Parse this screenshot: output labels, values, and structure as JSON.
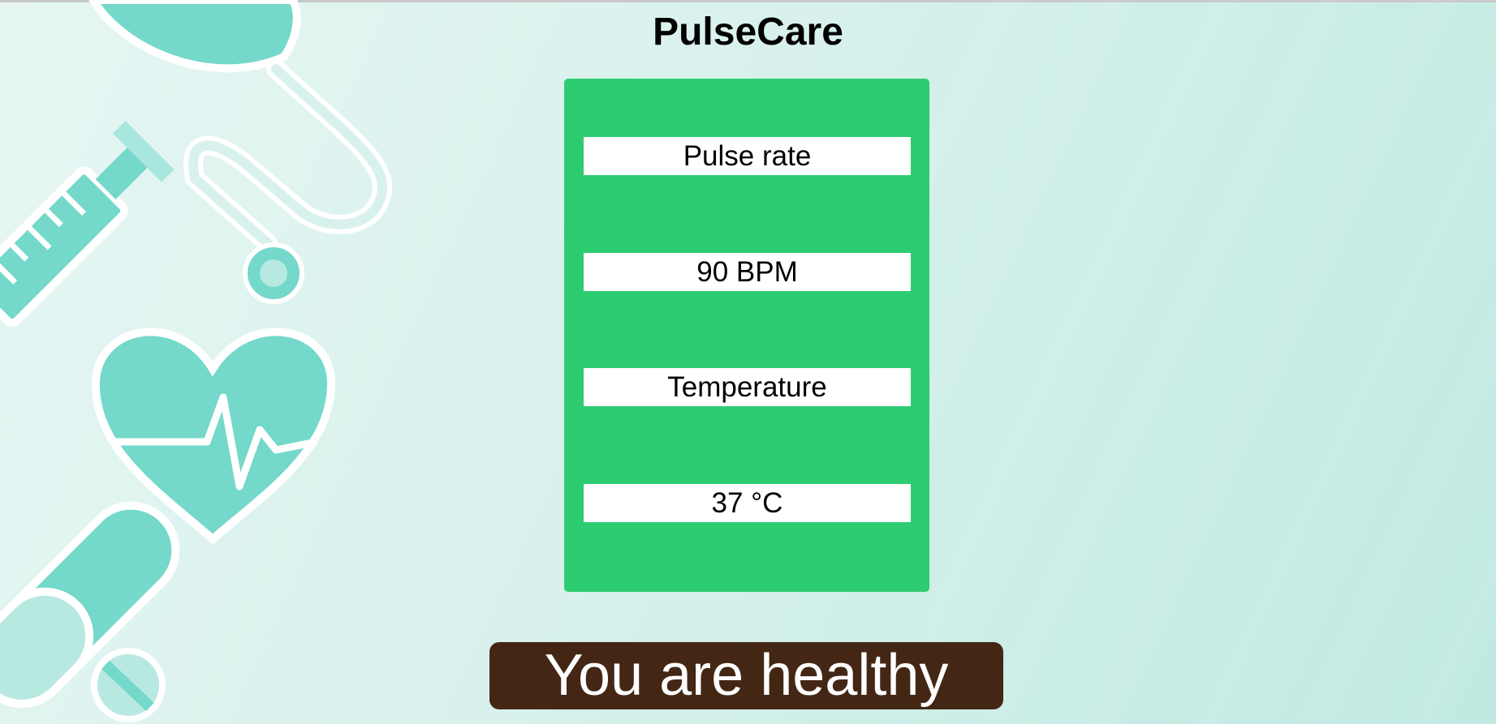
{
  "app": {
    "title": "PulseCare"
  },
  "vitals": {
    "pulse_label": "Pulse rate",
    "pulse_value": "90 BPM",
    "temperature_label": "Temperature",
    "temperature_value": "37 °C"
  },
  "status": {
    "message": "You are healthy"
  },
  "colors": {
    "card": "#2ecc71",
    "status_bg": "#432714",
    "illustration": "#74d8cb",
    "background": "#d8f1ec"
  },
  "icons": [
    "stethoscope-icon",
    "syringe-icon",
    "heart-pulse-icon",
    "pill-capsule-icon",
    "tablet-icon"
  ]
}
